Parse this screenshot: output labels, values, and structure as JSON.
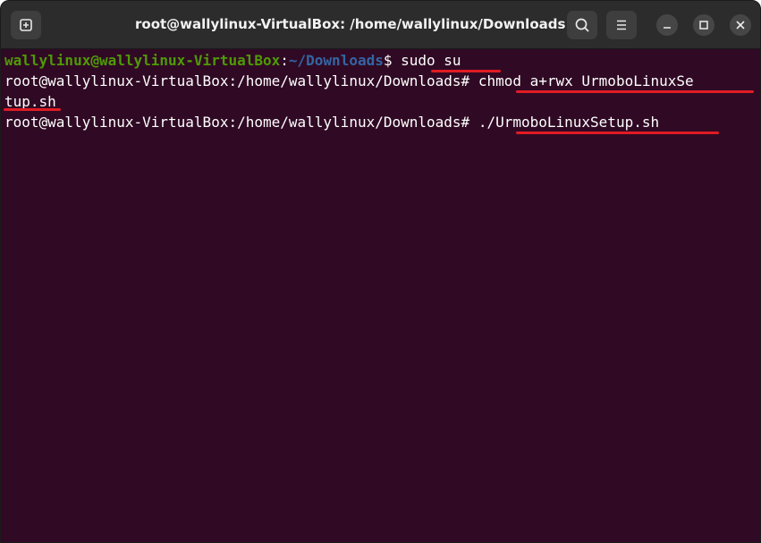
{
  "window": {
    "title": "root@wallylinux-VirtualBox: /home/wallylinux/Downloads"
  },
  "icons": {
    "new_tab": "new-tab-icon",
    "search": "search-icon",
    "menu": "hamburger-menu-icon",
    "minimize": "minimize-icon",
    "maximize": "maximize-icon",
    "close": "close-icon"
  },
  "terminal": {
    "line1": {
      "user_host": "wallylinux@wallylinux-VirtualBox",
      "colon": ":",
      "path": "~/Downloads",
      "symbol": "$ ",
      "command": "sudo su"
    },
    "line2": {
      "prompt": "root@wallylinux-VirtualBox:/home/wallylinux/Downloads# ",
      "command": "chmod a+rwx UrmoboLinuxSe"
    },
    "line3": {
      "command": "tup.sh"
    },
    "line4": {
      "prompt": "root@wallylinux-VirtualBox:/home/wallylinux/Downloads# ",
      "command": "./UrmoboLinuxSetup.sh"
    }
  },
  "colors": {
    "terminal_bg": "#300a24",
    "prompt_user": "#4e9a06",
    "prompt_path": "#3465a4",
    "annotation_underline": "#e01b24"
  }
}
